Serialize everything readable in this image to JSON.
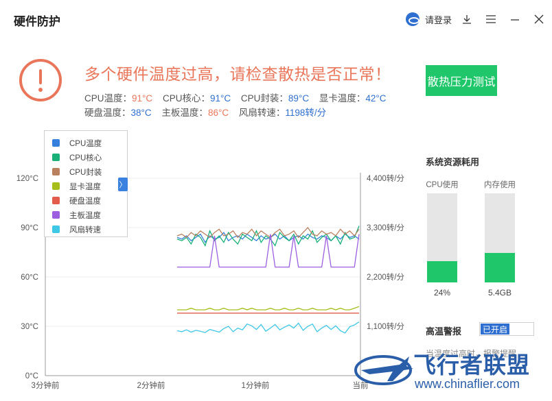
{
  "window": {
    "title": "硬件防护",
    "login_label": "请登录"
  },
  "alert": {
    "title": "多个硬件温度过高，请检查散热是否正常！",
    "stats": [
      {
        "label": "CPU温度：",
        "value": "91°C",
        "color": "#e9765a"
      },
      {
        "label": "CPU核心：",
        "value": "91°C",
        "color": "#2f6fd0"
      },
      {
        "label": "CPU封装：",
        "value": "89°C",
        "color": "#2f6fd0"
      },
      {
        "label": "显卡温度：",
        "value": "42°C",
        "color": "#2f6fd0"
      },
      {
        "label": "硬盘温度：",
        "value": "38°C",
        "color": "#2f6fd0"
      },
      {
        "label": "主板温度：",
        "value": "86°C",
        "color": "#e9765a"
      },
      {
        "label": "风扇转速：",
        "value": "1198转/分",
        "color": "#2f6fd0"
      }
    ]
  },
  "stress_test_button": "散热压力测试",
  "legend": {
    "items": [
      {
        "label": "CPU温度",
        "color": "#3580dc"
      },
      {
        "label": "CPU核心",
        "color": "#19b178"
      },
      {
        "label": "CPU封装",
        "color": "#b98060"
      },
      {
        "label": "显卡温度",
        "color": "#a6bd1a"
      },
      {
        "label": "硬盘温度",
        "color": "#e25b4b"
      },
      {
        "label": "主板温度",
        "color": "#9c5fe0"
      },
      {
        "label": "风扇转速",
        "color": "#3fc8e6"
      }
    ],
    "toggle_glyph": "〉"
  },
  "chart_data": {
    "type": "line",
    "left_axis": {
      "ticks": [
        "0°C",
        "30°C",
        "60°C",
        "90°C",
        "120°C"
      ],
      "range": [
        0,
        120
      ]
    },
    "right_axis": {
      "ticks": [
        "1,100转/分",
        "2,200转/分",
        "3,300转/分",
        "4,400转/分"
      ],
      "range": [
        0,
        4400
      ]
    },
    "x_ticks": [
      "3分钟前",
      "2分钟前",
      "1分钟前",
      "当前"
    ],
    "grid": true,
    "x_range_seconds_ago": [
      180,
      0
    ],
    "series": [
      {
        "name": "CPU温度",
        "axis": "left",
        "color": "#3580dc",
        "values": [
          84,
          83,
          85,
          82,
          84,
          86,
          81,
          85,
          83,
          84,
          87,
          82,
          84,
          85,
          83,
          86,
          84,
          82,
          85,
          83,
          84,
          86,
          83,
          85,
          82,
          84,
          85,
          83,
          86,
          84,
          83,
          85,
          84,
          82,
          85,
          83,
          86,
          84,
          85,
          83
        ]
      },
      {
        "name": "CPU核心",
        "axis": "left",
        "color": "#19b178",
        "values": [
          83,
          82,
          84,
          80,
          86,
          84,
          79,
          88,
          82,
          85,
          81,
          87,
          83,
          80,
          86,
          84,
          82,
          88,
          81,
          85,
          83,
          79,
          87,
          84,
          82,
          86,
          80,
          85,
          83,
          88,
          81,
          84,
          86,
          82,
          85,
          80,
          87,
          83,
          84,
          91
        ]
      },
      {
        "name": "CPU封装",
        "axis": "left",
        "color": "#b98060",
        "values": [
          85,
          86,
          84,
          87,
          85,
          88,
          86,
          84,
          87,
          89,
          85,
          86,
          88,
          84,
          87,
          86,
          89,
          85,
          88,
          86,
          84,
          87,
          89,
          85,
          86,
          88,
          84,
          87,
          90,
          86,
          85,
          88,
          86,
          87,
          85,
          89,
          86,
          88,
          85,
          89
        ]
      },
      {
        "name": "显卡温度",
        "axis": "left",
        "color": "#a6bd1a",
        "values": [
          40,
          40,
          40,
          41,
          40,
          40,
          40,
          41,
          40,
          40,
          41,
          40,
          40,
          40,
          41,
          40,
          41,
          40,
          40,
          40,
          41,
          40,
          40,
          41,
          40,
          40,
          41,
          40,
          40,
          41,
          40,
          40,
          40,
          41,
          40,
          41,
          40,
          40,
          41,
          42
        ]
      },
      {
        "name": "硬盘温度",
        "axis": "left",
        "color": "#e25b4b",
        "values": [
          38,
          38,
          38,
          38,
          38,
          38,
          38,
          38,
          38,
          38,
          38,
          38,
          38,
          38,
          38,
          38,
          38,
          38,
          38,
          38,
          38,
          38,
          38,
          38,
          38,
          38,
          38,
          38,
          38,
          38,
          38,
          38,
          38,
          38,
          38,
          38,
          38,
          38,
          38,
          38
        ]
      },
      {
        "name": "主板温度",
        "axis": "left",
        "color": "#9c5fe0",
        "values": [
          66,
          66,
          66,
          66,
          66,
          66,
          66,
          66,
          85,
          66,
          66,
          66,
          66,
          66,
          66,
          66,
          66,
          66,
          66,
          66,
          86,
          66,
          66,
          66,
          66,
          85,
          66,
          66,
          66,
          66,
          66,
          66,
          85,
          66,
          66,
          66,
          66,
          66,
          66,
          86
        ]
      },
      {
        "name": "风扇转速",
        "axis": "right",
        "color": "#3fc8e6",
        "values": [
          1000,
          980,
          1020,
          970,
          1010,
          990,
          960,
          1030,
          1000,
          970,
          1050,
          1100,
          980,
          1060,
          1020,
          1150,
          1110,
          1030,
          1140,
          990,
          1060,
          1140,
          1020,
          1080,
          1130,
          1060,
          1170,
          1010,
          1100,
          1150,
          980,
          1060,
          1120,
          1030,
          1110,
          1000,
          950,
          1090,
          1130,
          1198
        ]
      }
    ]
  },
  "resources": {
    "title": "系统资源耗用",
    "cpu": {
      "label": "CPU使用",
      "value": "24%",
      "fraction": 0.24
    },
    "memory": {
      "label": "内存使用",
      "value": "5.4GB",
      "fraction": 0.33
    }
  },
  "high_temp_alert": {
    "label": "高温警报",
    "toggle_state": "已开启",
    "description": "当温度过高时，报警提醒"
  },
  "watermark": {
    "brand": "飞行者联盟",
    "url": "www.chinaflier.com"
  }
}
